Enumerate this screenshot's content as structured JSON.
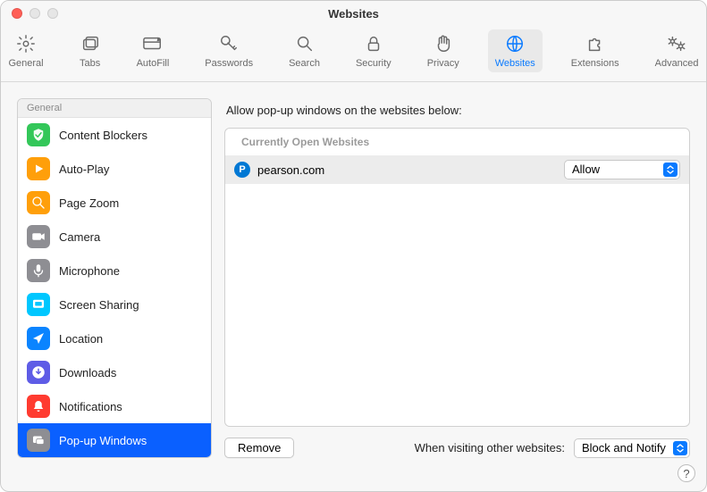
{
  "window": {
    "title": "Websites"
  },
  "toolbar": {
    "items": [
      {
        "label": "General",
        "icon": "gear"
      },
      {
        "label": "Tabs",
        "icon": "tabs"
      },
      {
        "label": "AutoFill",
        "icon": "autofill"
      },
      {
        "label": "Passwords",
        "icon": "key"
      },
      {
        "label": "Search",
        "icon": "search"
      },
      {
        "label": "Security",
        "icon": "lock"
      },
      {
        "label": "Privacy",
        "icon": "hand"
      },
      {
        "label": "Websites",
        "icon": "globe",
        "active": true
      },
      {
        "label": "Extensions",
        "icon": "puzzle"
      },
      {
        "label": "Advanced",
        "icon": "gears"
      }
    ]
  },
  "sidebar": {
    "header": "General",
    "items": [
      {
        "label": "Content Blockers",
        "icon": "content-blockers",
        "bg": "#33c759"
      },
      {
        "label": "Auto-Play",
        "icon": "play",
        "bg": "#ff9f0a"
      },
      {
        "label": "Page Zoom",
        "icon": "zoom",
        "bg": "#ff9f0a"
      },
      {
        "label": "Camera",
        "icon": "camera",
        "bg": "#8e8e93"
      },
      {
        "label": "Microphone",
        "icon": "mic",
        "bg": "#8e8e93"
      },
      {
        "label": "Screen Sharing",
        "icon": "screen",
        "bg": "#00c7ff"
      },
      {
        "label": "Location",
        "icon": "location",
        "bg": "#0a84ff"
      },
      {
        "label": "Downloads",
        "icon": "download",
        "bg": "#5e5ce6"
      },
      {
        "label": "Notifications",
        "icon": "bell",
        "bg": "#ff3b30"
      },
      {
        "label": "Pop-up Windows",
        "icon": "popup",
        "bg": "#8e8e93",
        "selected": true
      }
    ]
  },
  "main": {
    "heading": "Allow pop-up windows on the websites below:",
    "section_header": "Currently Open Websites",
    "rows": [
      {
        "site": "pearson.com",
        "favicon": "P",
        "value": "Allow"
      }
    ],
    "remove_label": "Remove",
    "default_label": "When visiting other websites:",
    "default_value": "Block and Notify"
  },
  "help": "?"
}
